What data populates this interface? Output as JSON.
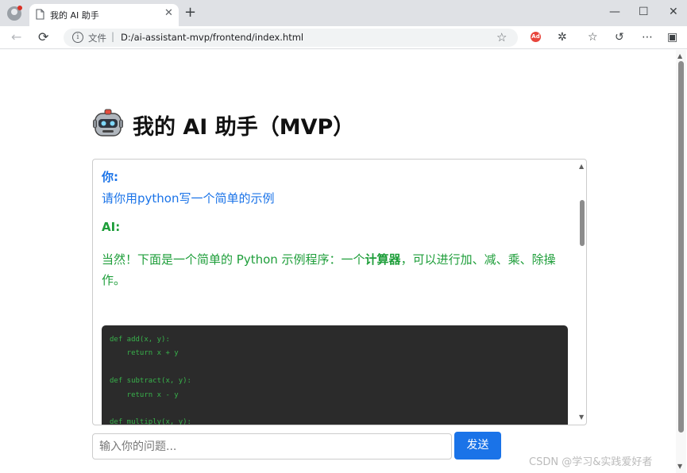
{
  "browser": {
    "tab_title": "我的 AI 助手",
    "tab_close": "✕",
    "new_tab": "+",
    "window_controls": {
      "minimize": "—",
      "maximize": "☐",
      "close": "✕"
    },
    "nav": {
      "back": "←",
      "reload": "⟳"
    },
    "address": {
      "scheme_label": "文件",
      "separator": "|",
      "url": "D:/ai-assistant-mvp/frontend/index.html"
    },
    "icons": [
      "star-icon",
      "extension-icon",
      "puzzle-icon",
      "favorites-icon",
      "history-icon",
      "more-icon",
      "sidebar-icon"
    ]
  },
  "page": {
    "title": "我的 AI 助手（MVP）",
    "logo_icon": "robot-icon"
  },
  "chat": {
    "messages": [
      {
        "role_label": "你:",
        "text": "请你用python写一个简单的示例"
      },
      {
        "role_label": "AI:",
        "intro_before": "当然！下面是一个简单的 Python 示例程序：一个",
        "intro_bold": "计算器",
        "intro_after": "，可以进行加、减、乘、除操作。"
      }
    ],
    "code": "def add(x, y):\n    return x + y\n\ndef subtract(x, y):\n    return x - y\n\ndef multiply(x, y):"
  },
  "composer": {
    "placeholder": "输入你的问题...",
    "value": "",
    "send_label": "发送"
  },
  "watermark": "CSDN @学习&实践爱好者",
  "colors": {
    "user": "#1a73e8",
    "ai": "#1e9e3a",
    "send_button": "#1a73e8",
    "code_bg": "#2b2b2b"
  }
}
